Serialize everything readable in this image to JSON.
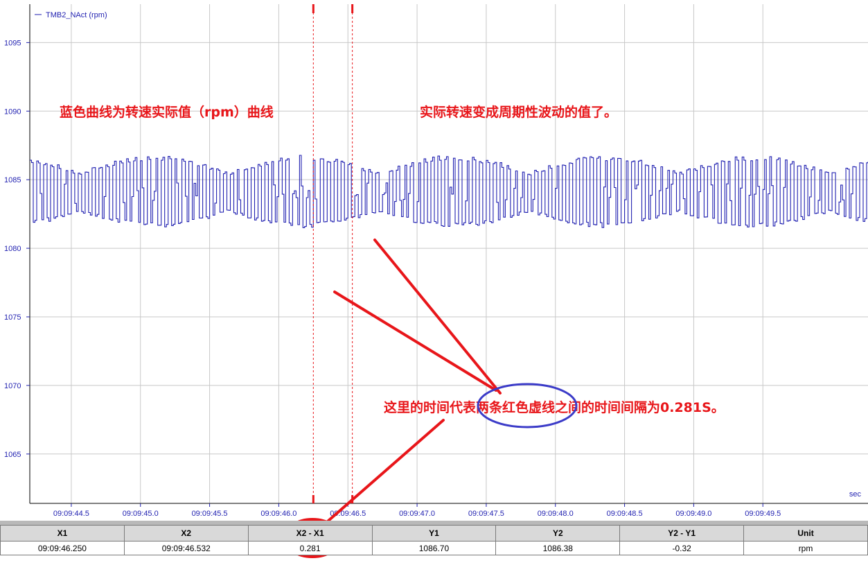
{
  "chart_data": {
    "type": "line",
    "title": "",
    "xlabel": "",
    "ylabel": "",
    "x_unit": "sec",
    "x_range": [
      "09:09:44.200",
      "09:09:50.260"
    ],
    "x_ticks": [
      "09:09:44.5",
      "09:09:45.0",
      "09:09:45.5",
      "09:09:46.0",
      "09:09:46.5",
      "09:09:47.0",
      "09:09:47.5",
      "09:09:48.0",
      "09:09:48.5",
      "09:09:49.0",
      "09:09:49.5"
    ],
    "ylim": [
      1061.4,
      1097.8
    ],
    "y_ticks": [
      1065,
      1070,
      1075,
      1080,
      1085,
      1090,
      1095
    ],
    "grid": true,
    "legend_position": "top-left",
    "series": [
      {
        "name": "TMB2_NAct (rpm)",
        "color": "#1f1fb0",
        "y_min": 1081.5,
        "y_max": 1086.8,
        "y_center": 1084.0,
        "shape": "step, periodic fluctuation"
      }
    ],
    "cursors": [
      {
        "label": "X1",
        "time": "09:09:46.250",
        "color": "#e8161a"
      },
      {
        "label": "X2",
        "time": "09:09:46.532",
        "color": "#e8161a"
      }
    ]
  },
  "annotations": {
    "text_1": "蓝色曲线为转速实际值（rpm）曲线",
    "text_2": "实际转速变成周期性波动的值了。",
    "text_3": "这里的时间代表两条红色虚线之间的时间间隔为0.281S。",
    "color": "#e8161a",
    "circle_color": "#3b3bc8"
  },
  "cursor_table": {
    "headers": [
      "X1",
      "X2",
      "X2 - X1",
      "Y1",
      "Y2",
      "Y2 - Y1",
      "Unit"
    ],
    "values": [
      "09:09:46.250",
      "09:09:46.532",
      "0.281",
      "1086.70",
      "1086.38",
      "-0.32",
      "rpm"
    ]
  }
}
